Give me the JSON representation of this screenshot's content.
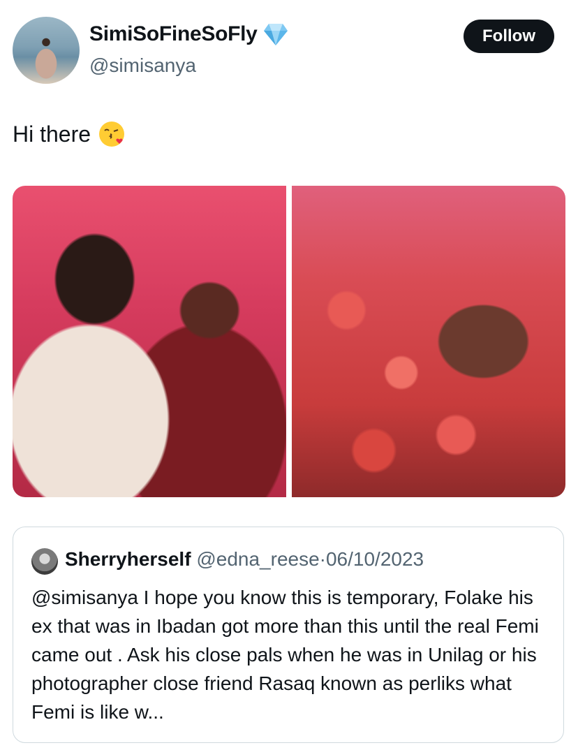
{
  "author": {
    "display_name": "SimiSoFineSoFly",
    "handle": "@simisanya",
    "verified_icon": "gem-icon"
  },
  "follow_label": "Follow",
  "tweet": {
    "text": "Hi there",
    "emoji_icon": "kissing-face-icon"
  },
  "media": [
    {
      "alt": "photo-couple"
    },
    {
      "alt": "photo-roses-ring"
    }
  ],
  "quote": {
    "display_name": "Sherryherself",
    "handle": "@edna_reese",
    "separator": "·",
    "date": "06/10/2023",
    "body": "@simisanya  I hope you know this is temporary, Folake his ex that was in Ibadan got more than this until the real Femi came out .  Ask his close pals when he was in Unilag or his photographer close friend Rasaq known as perliks what Femi is like w..."
  },
  "colors": {
    "follow_bg": "#0f1419",
    "muted_text": "#536471",
    "border": "#cfd9de"
  }
}
